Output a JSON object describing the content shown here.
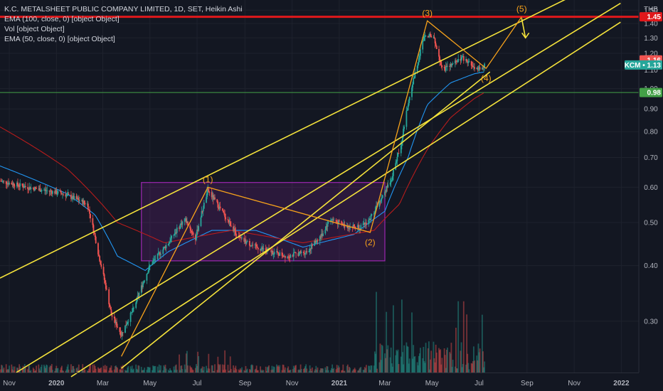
{
  "legend": {
    "title": "K.C. METALSHEET PUBLIC COMPANY LIMITED, 1D, SET, Heikin Ashi",
    "line1": "EMA (100, close, 0) [object Object]",
    "line2": "Vol [object Object]",
    "line3": "EMA (50, close, 0) [object Object]"
  },
  "colors": {
    "background": "#131722",
    "up": "#26a69a",
    "down": "#ef5350",
    "channel": "#f5e33b",
    "wave": "#f7a21b",
    "box": "#9c27b0",
    "resistance": "#e0181b",
    "support": "#43a047",
    "ema50": "#2196f3",
    "ema100": "#b71c1c"
  },
  "chart_data": {
    "type": "candlestick",
    "symbol": "KCM",
    "currency": "THB",
    "y_ticks": [
      0.3,
      0.4,
      0.5,
      0.6,
      0.7,
      0.8,
      0.9,
      1.0,
      1.1,
      1.2,
      1.3,
      1.4,
      1.5
    ],
    "x_ticks": [
      "Nov",
      "2020",
      "Mar",
      "May",
      "Jul",
      "Sep",
      "Nov",
      "2021",
      "Mar",
      "May",
      "Jul",
      "Sep",
      "Nov",
      "2022"
    ],
    "x_ticks_bold": [
      "2020",
      "2021",
      "2022"
    ],
    "ylim": [
      0.23,
      1.57
    ],
    "price_tags": {
      "resistance": "1.45",
      "prev": "1.16",
      "last_label": "KCM",
      "last": "1.13",
      "support": "0.98"
    },
    "horizontal_lines": {
      "resistance": 1.45,
      "support": 0.98
    },
    "wave_labels": [
      "(1)",
      "(2)",
      "(3)",
      "(4)",
      "(5)"
    ],
    "wave_path": [
      [
        "2020-03-25",
        0.25
      ],
      [
        "2020-07-15",
        0.6
      ],
      [
        "2021-02-10",
        0.475
      ],
      [
        "2021-04-25",
        1.42
      ],
      [
        "2021-07-10",
        1.11
      ],
      [
        "2021-08-25",
        1.45
      ]
    ],
    "projection_arrow": [
      [
        "2021-08-25",
        1.44
      ],
      [
        "2021-08-30",
        1.3
      ]
    ],
    "consolidation_box": {
      "x": [
        "2020-04-20",
        "2021-03-01"
      ],
      "y": [
        0.41,
        0.615
      ]
    },
    "channels": [
      [
        [
          "2019-10-20",
          0.375
        ],
        [
          "2021-10-25",
          1.6
        ]
      ],
      [
        [
          "2019-11-10",
          0.23
        ],
        [
          "2021-12-31",
          1.555
        ]
      ],
      [
        [
          "2020-01-20",
          0.225
        ],
        [
          "2021-12-31",
          1.41
        ]
      ],
      [
        [
          "2020-03-25",
          0.235
        ],
        [
          "2021-07-15",
          1.09
        ]
      ]
    ],
    "series": [
      {
        "name": "KCM",
        "anchors": [
          [
            "2019-10-20",
            0.62
          ],
          [
            "2019-11-25",
            0.6
          ],
          [
            "2020-01-10",
            0.58
          ],
          [
            "2020-02-10",
            0.55
          ],
          [
            "2020-02-25",
            0.42
          ],
          [
            "2020-03-12",
            0.31
          ],
          [
            "2020-03-25",
            0.28
          ],
          [
            "2020-04-10",
            0.32
          ],
          [
            "2020-05-01",
            0.4
          ],
          [
            "2020-05-25",
            0.45
          ],
          [
            "2020-06-15",
            0.51
          ],
          [
            "2020-06-29",
            0.46
          ],
          [
            "2020-07-15",
            0.59
          ],
          [
            "2020-08-05",
            0.52
          ],
          [
            "2020-08-25",
            0.46
          ],
          [
            "2020-09-15",
            0.44
          ],
          [
            "2020-10-05",
            0.43
          ],
          [
            "2020-10-25",
            0.42
          ],
          [
            "2020-11-20",
            0.43
          ],
          [
            "2020-12-10",
            0.47
          ],
          [
            "2020-12-20",
            0.51
          ],
          [
            "2021-01-10",
            0.49
          ],
          [
            "2021-01-31",
            0.49
          ],
          [
            "2021-02-10",
            0.51
          ],
          [
            "2021-02-25",
            0.57
          ],
          [
            "2021-03-10",
            0.63
          ],
          [
            "2021-03-22",
            0.75
          ],
          [
            "2021-03-31",
            0.92
          ],
          [
            "2021-04-10",
            1.1
          ],
          [
            "2021-04-22",
            1.33
          ],
          [
            "2021-05-03",
            1.3
          ],
          [
            "2021-05-15",
            1.1
          ],
          [
            "2021-05-30",
            1.14
          ],
          [
            "2021-06-10",
            1.17
          ],
          [
            "2021-06-20",
            1.13
          ],
          [
            "2021-06-30",
            1.1
          ],
          [
            "2021-07-08",
            1.13
          ]
        ]
      },
      {
        "name": "EMA (50, close, 0)",
        "anchors": [
          [
            "2019-10-20",
            0.67
          ],
          [
            "2020-01-15",
            0.58
          ],
          [
            "2020-02-20",
            0.52
          ],
          [
            "2020-03-20",
            0.42
          ],
          [
            "2020-04-25",
            0.39
          ],
          [
            "2020-05-25",
            0.43
          ],
          [
            "2020-07-20",
            0.48
          ],
          [
            "2020-09-15",
            0.48
          ],
          [
            "2020-11-15",
            0.44
          ],
          [
            "2021-01-20",
            0.47
          ],
          [
            "2021-03-01",
            0.53
          ],
          [
            "2021-03-31",
            0.7
          ],
          [
            "2021-04-25",
            0.92
          ],
          [
            "2021-05-25",
            1.03
          ],
          [
            "2021-06-25",
            1.08
          ],
          [
            "2021-07-08",
            1.09
          ]
        ]
      },
      {
        "name": "EMA (100, close, 0)",
        "anchors": [
          [
            "2019-10-20",
            0.82
          ],
          [
            "2020-01-15",
            0.66
          ],
          [
            "2020-03-20",
            0.5
          ],
          [
            "2020-05-20",
            0.45
          ],
          [
            "2020-08-15",
            0.48
          ],
          [
            "2020-11-15",
            0.45
          ],
          [
            "2021-02-15",
            0.48
          ],
          [
            "2021-03-20",
            0.55
          ],
          [
            "2021-04-25",
            0.73
          ],
          [
            "2021-05-25",
            0.86
          ],
          [
            "2021-06-25",
            0.95
          ],
          [
            "2021-07-08",
            0.98
          ]
        ]
      }
    ]
  }
}
